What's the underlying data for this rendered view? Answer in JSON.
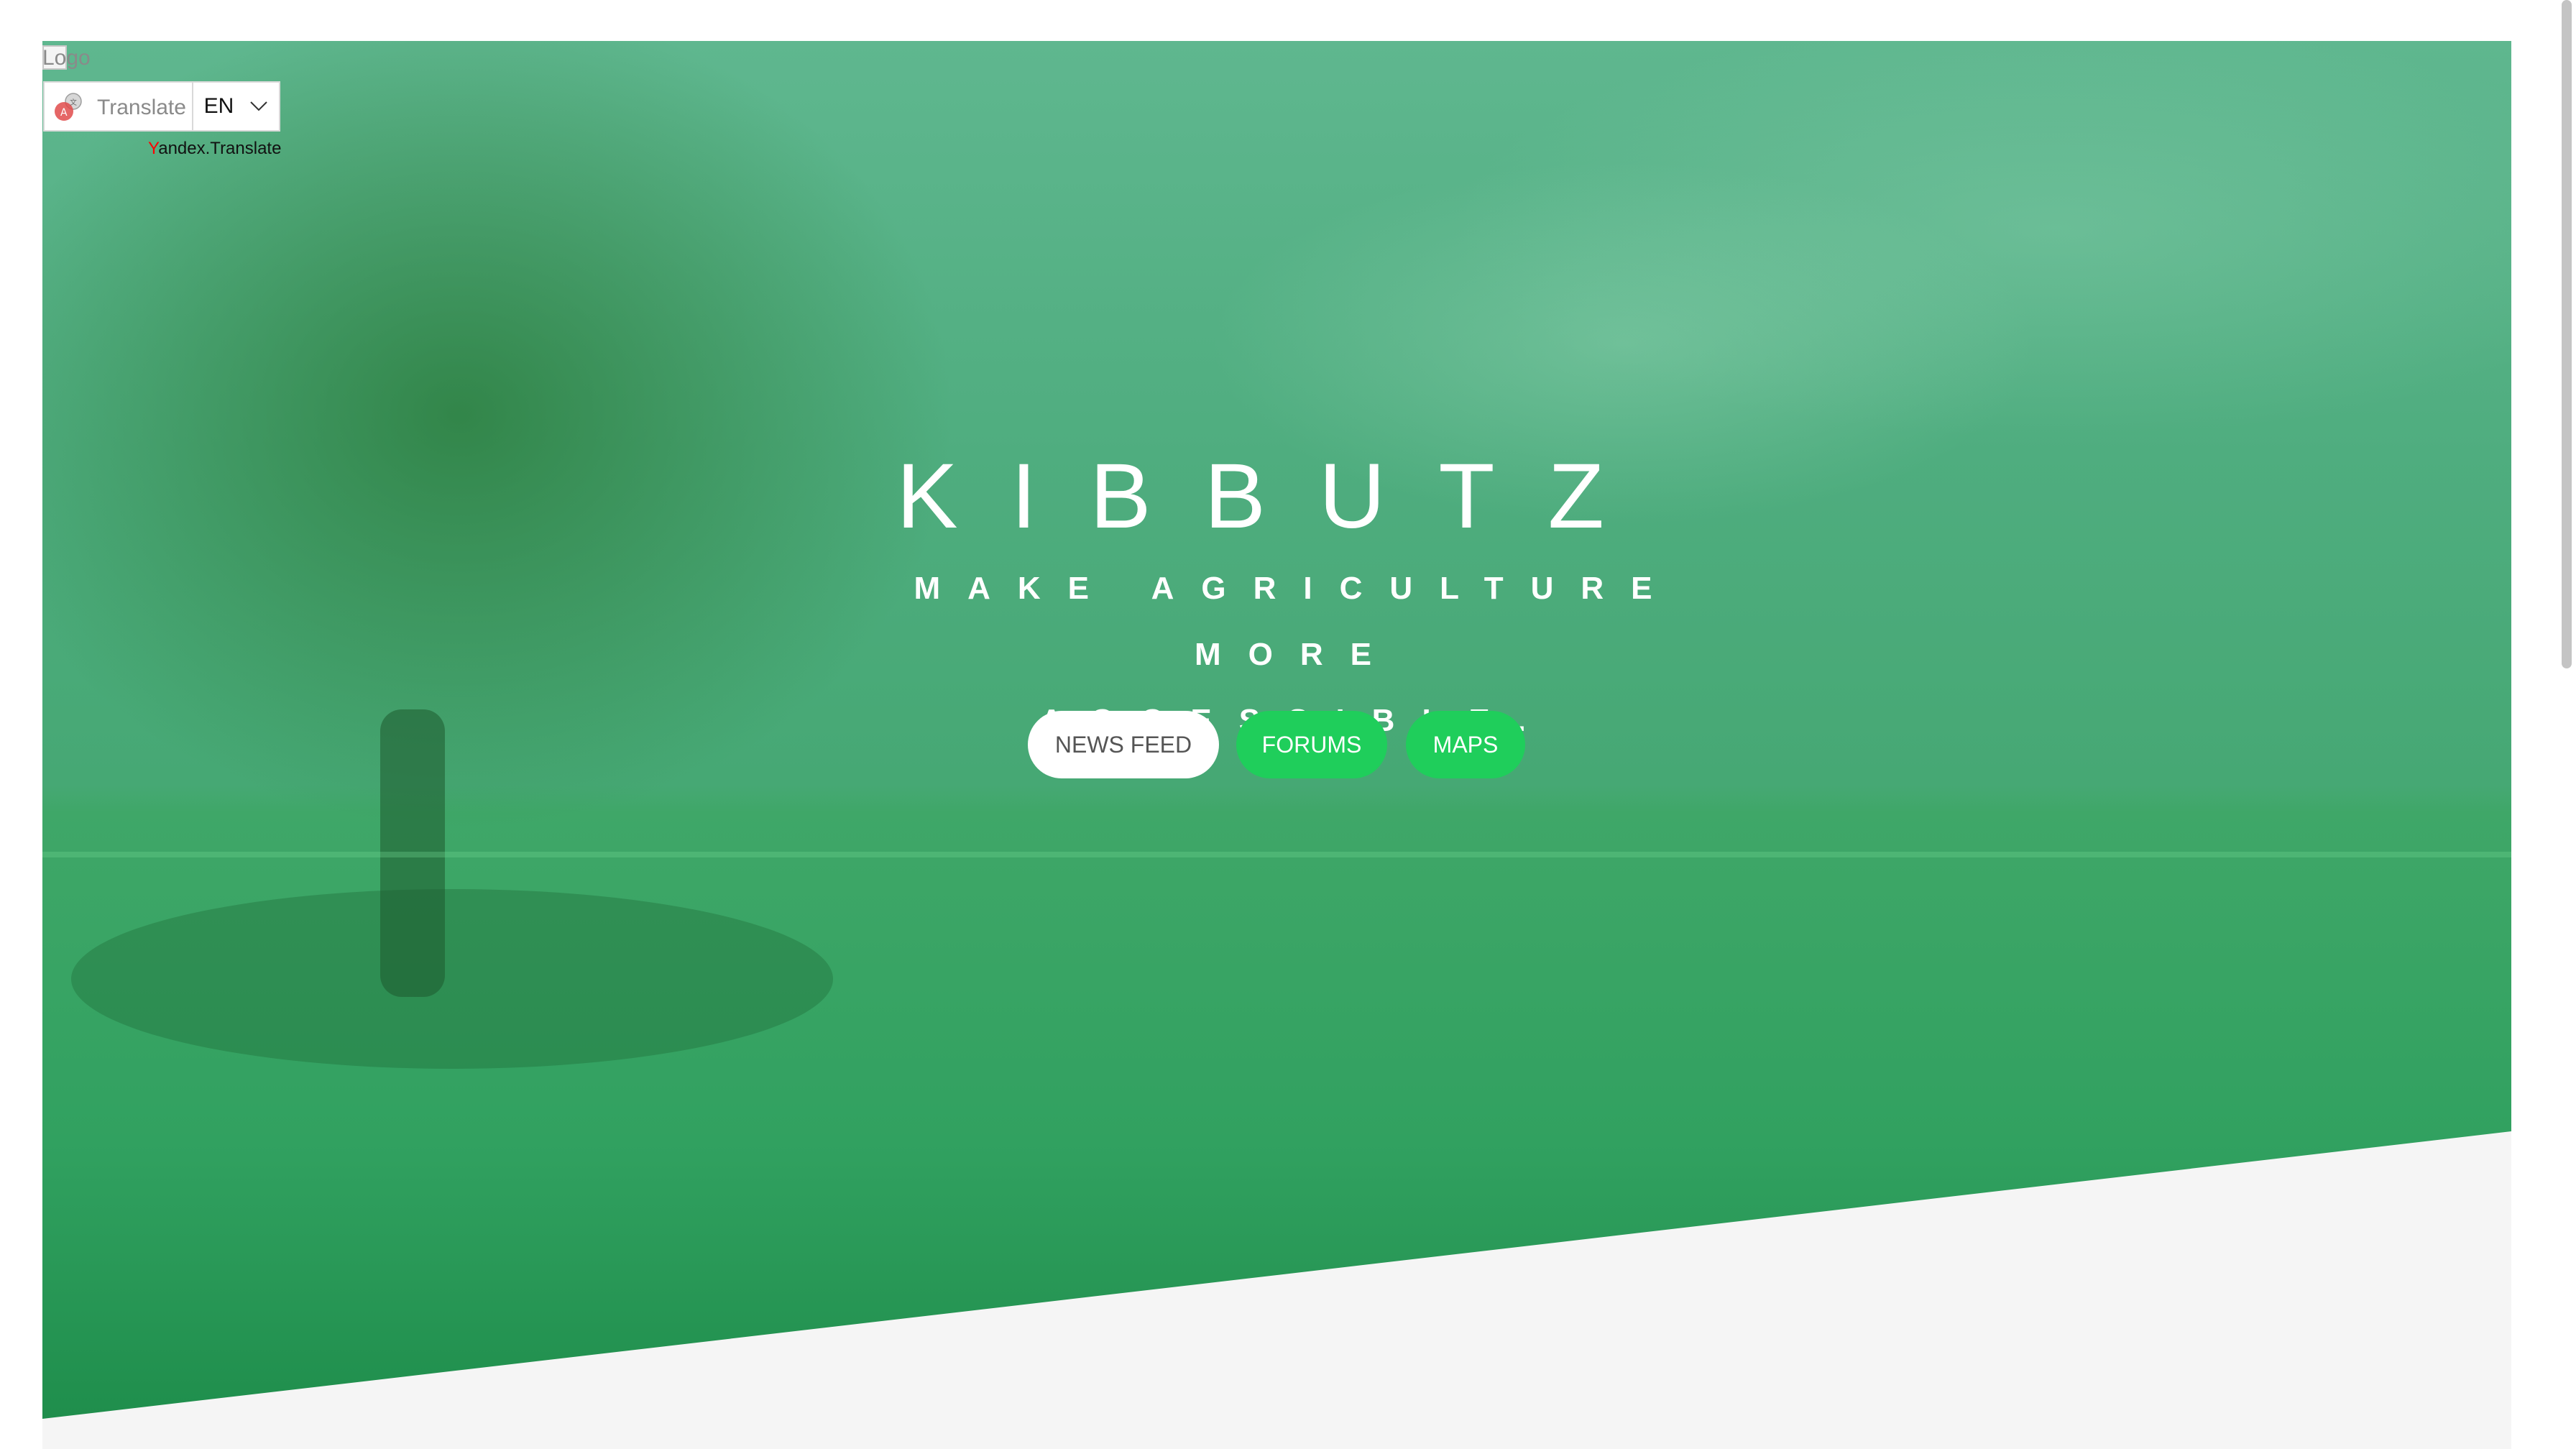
{
  "header": {
    "logo_alt": "Logo",
    "translate_label": "Translate",
    "language": "EN",
    "credit_prefix": "Y",
    "credit_rest": "andex.Translate"
  },
  "hero": {
    "title": "KIBBUTZ",
    "tagline_line1": "MAKE AGRICULTURE MORE",
    "tagline_line2": "ACCESSIBLE."
  },
  "buttons": {
    "news_feed": "NEWS FEED",
    "forums": "FORUMS",
    "maps": "MAPS"
  },
  "icons": {
    "translate_icon": "translate-icon",
    "dropdown_icon": "chevron-down-icon"
  },
  "colors": {
    "primary_green": "#1fce5b",
    "hero_green": "#3fa768",
    "button_white": "#ffffff",
    "background": "#f5f5f5"
  }
}
